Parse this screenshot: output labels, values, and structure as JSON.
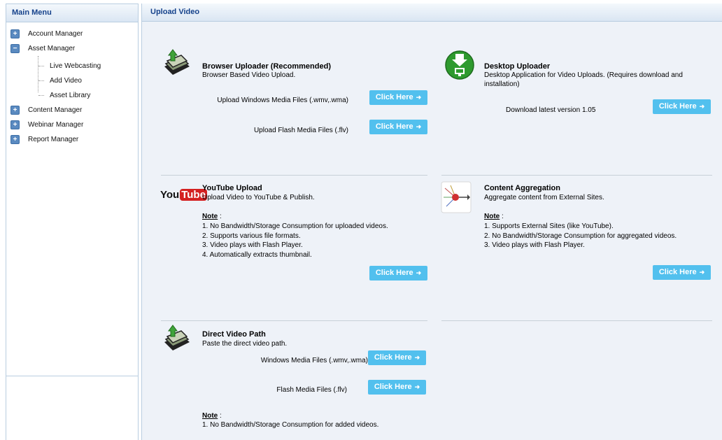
{
  "sidebar": {
    "title": "Main Menu",
    "items": [
      {
        "label": "Account Manager",
        "toggle": "+"
      },
      {
        "label": "Asset Manager",
        "toggle": "−"
      },
      {
        "label": "Content Manager",
        "toggle": "+"
      },
      {
        "label": "Webinar Manager",
        "toggle": "+"
      },
      {
        "label": "Report Manager",
        "toggle": "+"
      }
    ],
    "asset_children": [
      {
        "label": "Live Webcasting"
      },
      {
        "label": "Add Video"
      },
      {
        "label": "Asset Library"
      }
    ]
  },
  "main": {
    "title": "Upload Video",
    "button_label": "Click Here",
    "browser": {
      "title": "Browser Uploader  (Recommended)",
      "desc": "Browser Based Video Upload.",
      "row1": "Upload Windows Media Files (.wmv,.wma)",
      "row2": "Upload Flash Media Files (.flv)"
    },
    "desktop": {
      "title": "Desktop Uploader",
      "desc": "Desktop Application for Video Uploads. (Requires download and installation)",
      "row1": "Download latest version 1.05"
    },
    "youtube": {
      "logo_you": "You",
      "logo_tube": "Tube",
      "title": "YouTube Upload",
      "desc": "Upload Video to YouTube & Publish.",
      "note_title": "Note",
      "notes": [
        "1. No Bandwidth/Storage Consumption for uploaded videos.",
        "2. Supports various file formats.",
        "3. Video plays with Flash Player.",
        "4. Automatically extracts thumbnail."
      ]
    },
    "aggregation": {
      "title": "Content Aggregation",
      "desc": "Aggregate content from External Sites.",
      "note_title": "Note",
      "notes": [
        "1. Supports External Sites (like YouTube).",
        "2. No Bandwidth/Storage Consumption for aggregated videos.",
        "3. Video plays with Flash Player."
      ]
    },
    "direct": {
      "title": "Direct Video Path",
      "desc": "Paste the direct video path.",
      "row1": "Windows Media Files (.wmv,.wma)",
      "row2": "Flash Media Files (.flv)",
      "note_title": "Note",
      "notes": [
        "1. No Bandwidth/Storage Consumption for added videos."
      ]
    }
  }
}
